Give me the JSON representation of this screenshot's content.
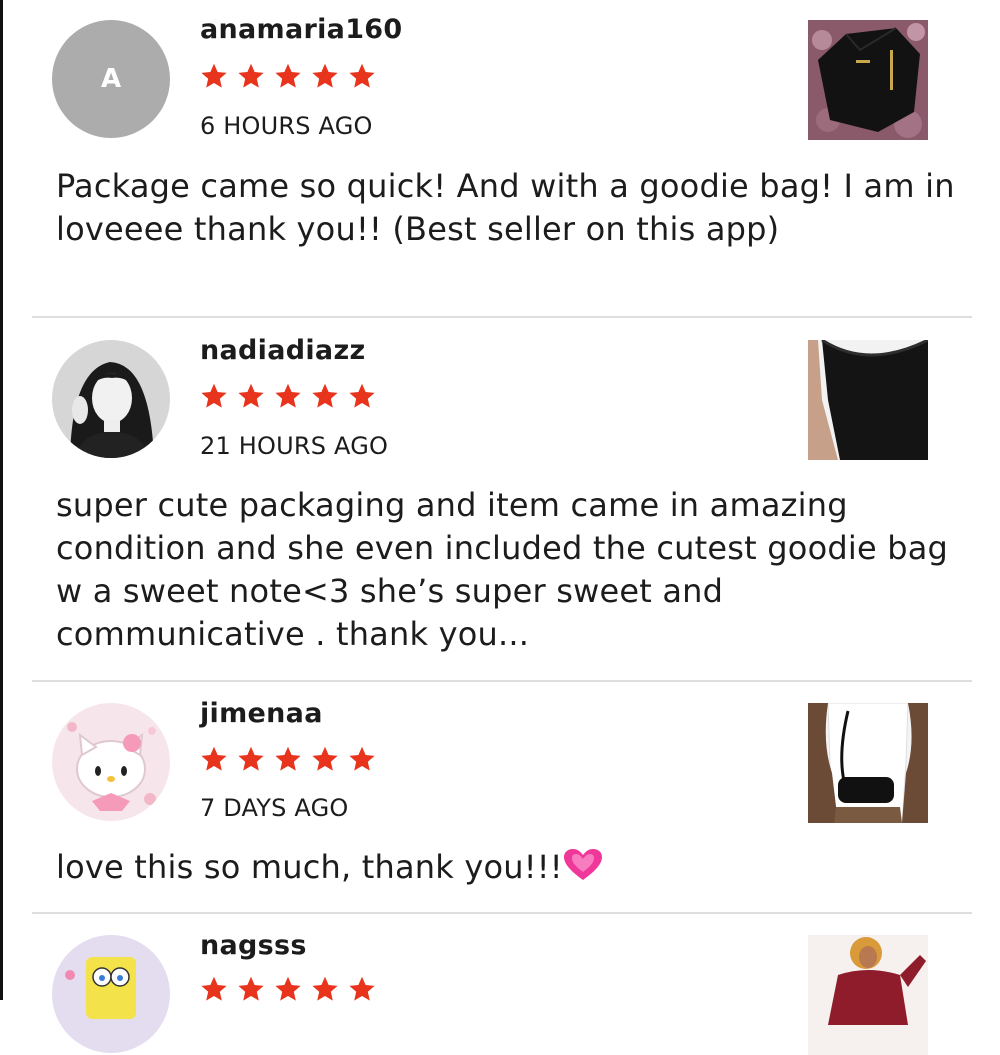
{
  "reviews": [
    {
      "username": "anamaria160",
      "avatar_letter": "A",
      "rating": 5,
      "time": "6 HOURS AGO",
      "text": "Package came so quick! And with a goodie bag! I am in loveeee thank you!! (Best seller on this app)",
      "thumb_icon": "black-hoodie-photo"
    },
    {
      "username": "nadiadiazz",
      "rating": 5,
      "time": "21 HOURS AGO",
      "text": "super cute packaging and item came in amazing condition and she even included the cutest goodie bag w a sweet note<3 she’s super sweet and communicative . thank you...",
      "thumb_icon": "black-leggings-photo"
    },
    {
      "username": "jimenaa",
      "rating": 5,
      "time": "7 DAYS AGO",
      "text": "love this so much, thank you!!!",
      "thumb_icon": "black-shoulder-bag-photo"
    },
    {
      "username": "nagsss",
      "rating": 5,
      "thumb_icon": "red-top-photo"
    }
  ],
  "colors": {
    "star": "#e8341c",
    "avatar_gray": "#acacac",
    "divider": "#dedede",
    "heart": "#f0389a"
  }
}
